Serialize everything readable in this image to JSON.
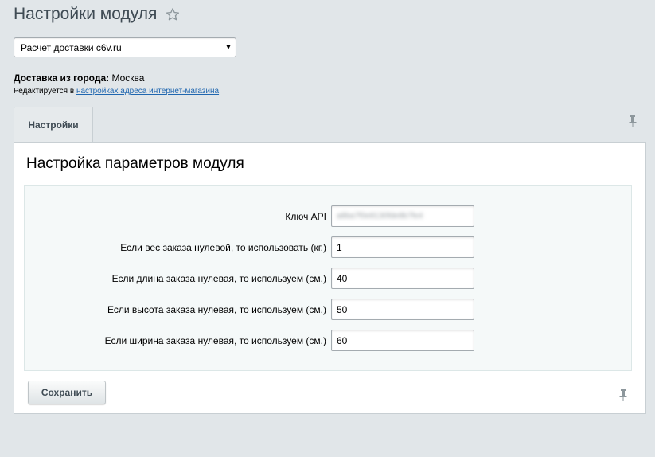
{
  "page": {
    "title": "Настройки модуля"
  },
  "module_select": {
    "value": "Расчет доставки c6v.ru"
  },
  "delivery": {
    "city_label": "Доставка из города:",
    "city_value": "Москва",
    "edited_prefix": "Редактируется в",
    "edited_link": "настройках адреса интернет-магазина"
  },
  "tabs": [
    {
      "label": "Настройки"
    }
  ],
  "section": {
    "title": "Настройка параметров модуля"
  },
  "form": {
    "fields": [
      {
        "label": "Ключ API",
        "value": "a8ba7f0e8130fde8b7fe4"
      },
      {
        "label": "Если вес заказа нулевой, то использовать (кг.)",
        "value": "1"
      },
      {
        "label": "Если длина заказа нулевая, то используем (см.)",
        "value": "40"
      },
      {
        "label": "Если высота заказа нулевая, то используем (см.)",
        "value": "50"
      },
      {
        "label": "Если ширина заказа нулевая, то используем (см.)",
        "value": "60"
      }
    ]
  },
  "actions": {
    "save_label": "Сохранить"
  },
  "colors": {
    "background": "#e1e6e9",
    "link": "#2067b0",
    "title": "#3f4b54"
  },
  "icons": [
    "star-icon",
    "pin-icon",
    "chevron-down-icon"
  ]
}
